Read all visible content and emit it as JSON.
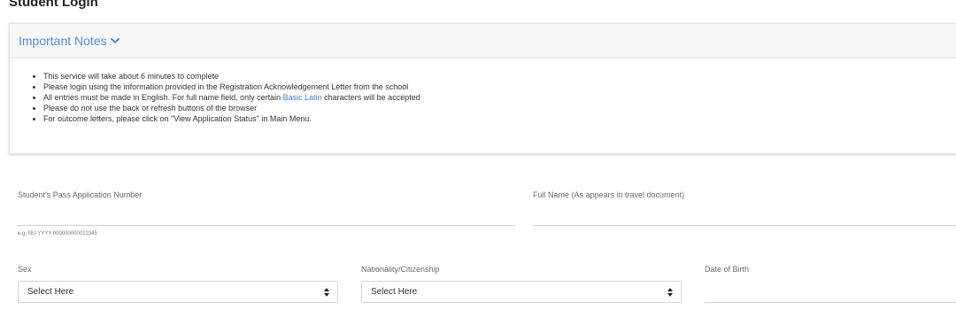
{
  "page": {
    "title": "Student Login"
  },
  "notes": {
    "header": "Important Notes",
    "items": [
      "This service will take about 6 minutes to complete",
      "Please login using the information provided in the Registration Acknowledgement Letter from the school"
    ],
    "item3_before": "All entries must be made in English. For full name field, only certain ",
    "item3_link": "Basic Latin",
    "item3_after": " characters will be accepted",
    "item4": "Please do not use the back or refresh buttons of the browser",
    "item5": "For outcome letters, please click on \"View Application Status\" in Main Menu."
  },
  "form": {
    "application_number": {
      "label": "Student's Pass Application Number",
      "value": "",
      "hint": "e.g. NU-YYYY-000000000012345"
    },
    "full_name": {
      "label": "Full Name (As appears in travel document)",
      "value": ""
    },
    "sex": {
      "label": "Sex",
      "selected": "Select Here"
    },
    "nationality": {
      "label": "Nationality/Citizenship",
      "selected": "Select Here"
    },
    "date_of_birth": {
      "label": "Date of Birth",
      "value": ""
    }
  },
  "colors": {
    "accent": "#4a90d9",
    "link": "#3b7dd8",
    "text": "#333333",
    "label": "#6a6a6a",
    "panel_header_bg": "#f7f7f7"
  },
  "icons": {
    "notes_toggle": "chevron-down-icon",
    "select_arrows": "sort-arrows-icon"
  }
}
